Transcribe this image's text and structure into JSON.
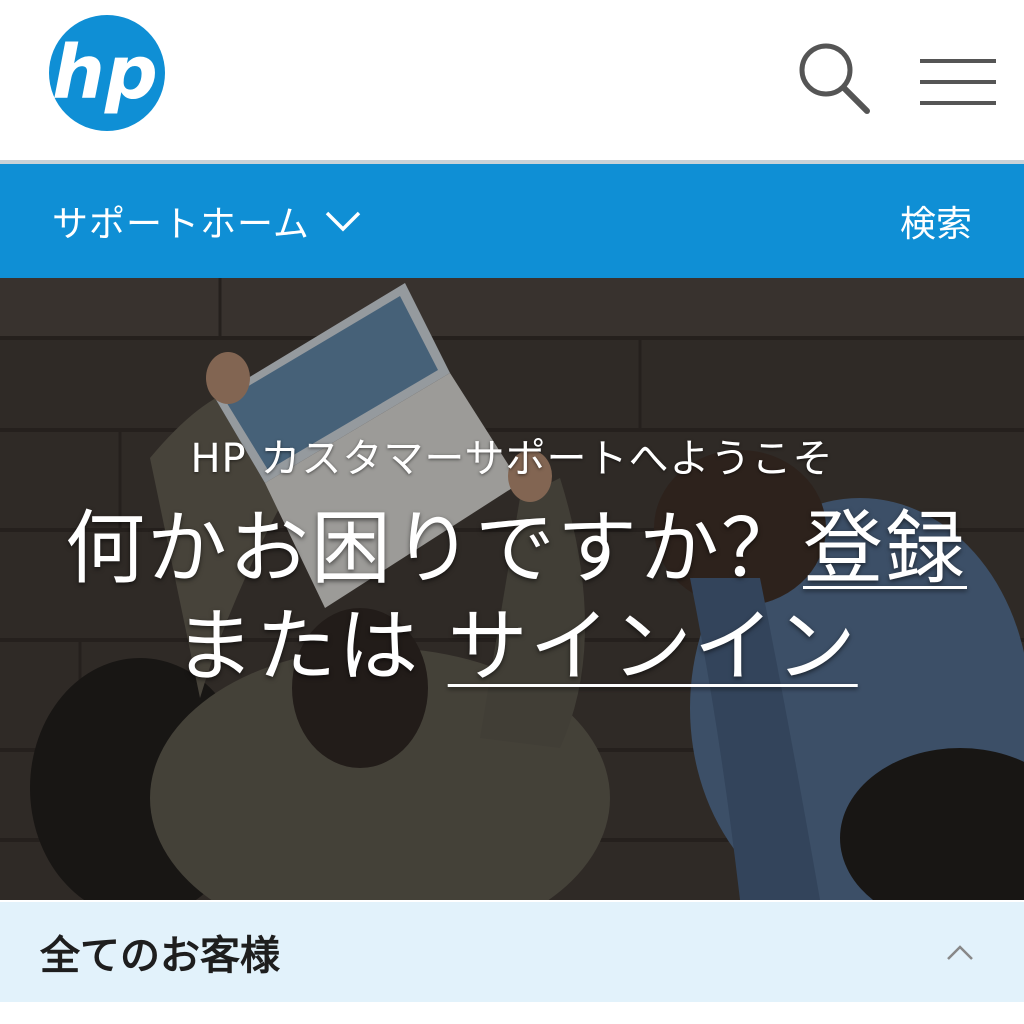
{
  "header": {
    "logo_text": "hp",
    "search_icon": "search-icon",
    "menu_icon": "hamburger-menu-icon",
    "brand_color": "#0f8fd5"
  },
  "nav": {
    "home_label": "サポートホーム",
    "home_icon": "chevron-down-icon",
    "search_label": "検索"
  },
  "hero": {
    "subtitle": "HP カスタマーサポートへようこそ",
    "title_prefix": "何かお困りですか？",
    "register_link": "登録",
    "title_middle": "または",
    "signin_link": "サインイン"
  },
  "accordion": {
    "title": "全てのお客様",
    "icon": "chevron-up-icon",
    "background": "#e2f2fb"
  }
}
